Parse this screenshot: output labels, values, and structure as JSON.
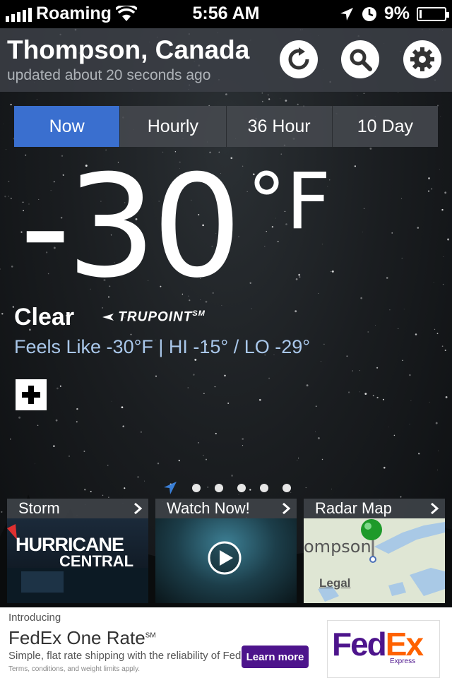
{
  "status_bar": {
    "carrier": "Roaming",
    "time": "5:56 AM",
    "battery": "9%",
    "battery_level": 0.09
  },
  "header": {
    "city": "Thompson, Canada",
    "updated": "updated about 20 seconds ago",
    "refresh_icon": "refresh-icon",
    "search_icon": "search-icon",
    "settings_icon": "gear-icon"
  },
  "tabs": [
    {
      "label": "Now",
      "active": true
    },
    {
      "label": "Hourly",
      "active": false
    },
    {
      "label": "36 Hour",
      "active": false
    },
    {
      "label": "10 Day",
      "active": false
    }
  ],
  "current": {
    "temperature": "-30",
    "unit": "°F",
    "condition": "Clear",
    "brand": "TRUPOINT",
    "brand_mark": "SM",
    "feels_like": "Feels Like -30°F | HI -15° / LO -29°"
  },
  "cards": [
    {
      "title": "Storm",
      "image_text_1": "HURRICANE",
      "image_text_2": "CENTRAL"
    },
    {
      "title": "Watch Now!"
    },
    {
      "title": "Radar Map",
      "map_text": "ompson",
      "map_legal": "Legal"
    }
  ],
  "ad": {
    "intro": "Introducing",
    "title": "FedEx One Rate",
    "title_mark": "SM",
    "subtitle": "Simple, flat rate shipping with the reliability of FedEx.",
    "terms": "Terms, conditions, and weight limits apply.",
    "button": "Learn more",
    "logo_fe": "Fed",
    "logo_ex": "Ex",
    "logo_sub": "Express"
  },
  "colors": {
    "accent": "#3a6fcf",
    "feels_like": "#a9c7ea",
    "fedex_purple": "#4d148c",
    "fedex_orange": "#ff6200"
  }
}
